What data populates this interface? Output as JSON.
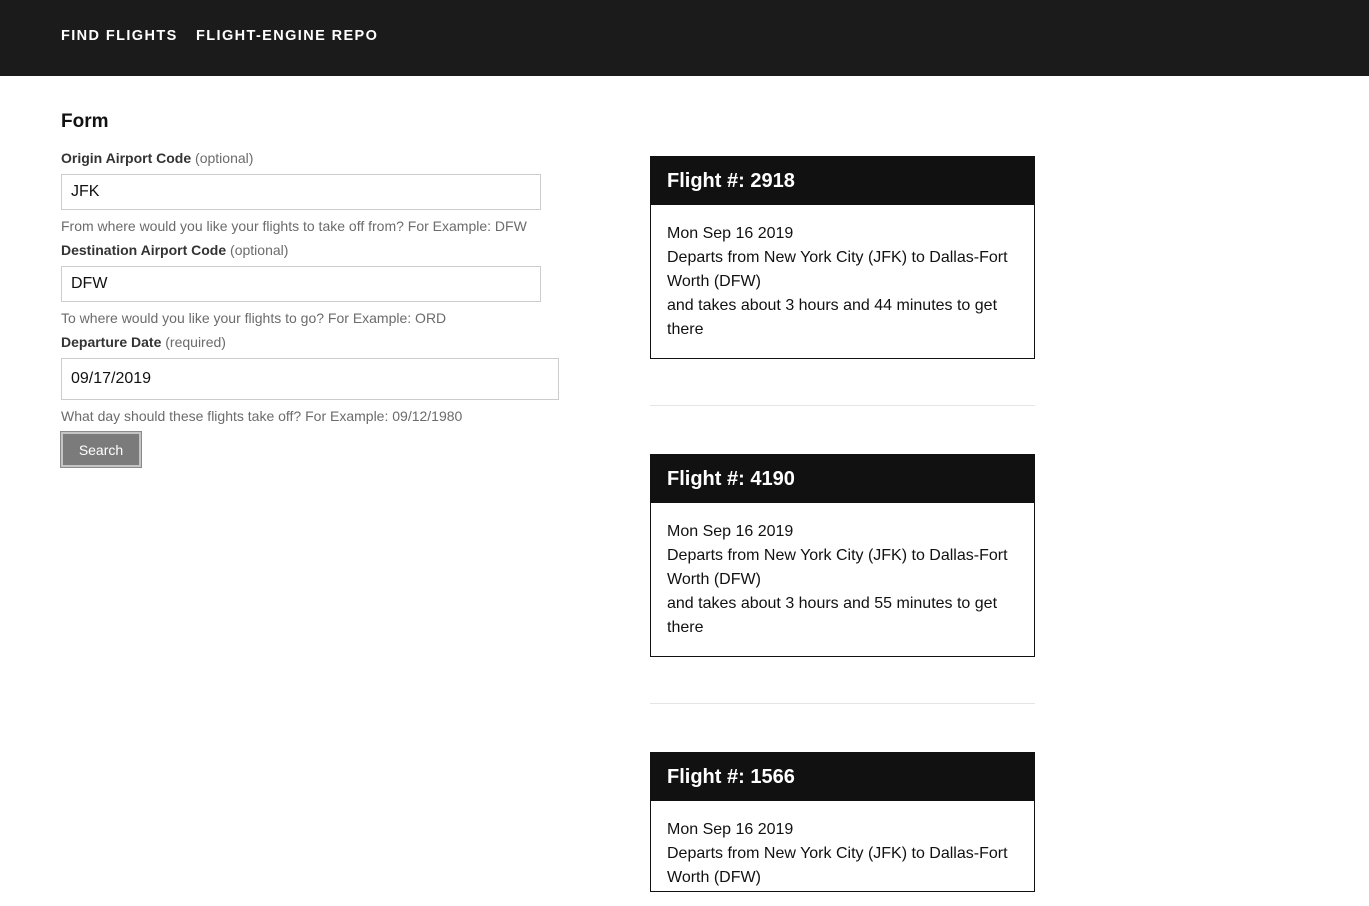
{
  "nav": {
    "find_flights": "FIND FLIGHTS",
    "repo": "FLIGHT-ENGINE REPO"
  },
  "form": {
    "title": "Form",
    "origin": {
      "label": "Origin Airport Code",
      "note": "(optional)",
      "value": "JFK",
      "help": "From where would you like your flights to take off from? For Example: DFW"
    },
    "destination": {
      "label": "Destination Airport Code",
      "note": "(optional)",
      "value": "DFW",
      "help": "To where would you like your flights to go? For Example: ORD"
    },
    "date": {
      "label": "Departure Date",
      "note": "(required)",
      "value": "09/17/2019",
      "help": "What day should these flights take off? For Example: 09/12/1980"
    },
    "search_label": "Search"
  },
  "flights": [
    {
      "title": "Flight #: 2918",
      "date": "Mon Sep 16 2019",
      "route": "Departs from New York City (JFK) to Dallas-Fort Worth (DFW)",
      "duration": "and takes about 3 hours and 44 minutes to get there"
    },
    {
      "title": "Flight #: 4190",
      "date": "Mon Sep 16 2019",
      "route": "Departs from New York City (JFK) to Dallas-Fort Worth (DFW)",
      "duration": "and takes about 3 hours and 55 minutes to get there"
    },
    {
      "title": "Flight #: 1566",
      "date": "Mon Sep 16 2019",
      "route": "Departs from New York City (JFK) to Dallas-Fort Worth (DFW)",
      "duration": ""
    }
  ]
}
